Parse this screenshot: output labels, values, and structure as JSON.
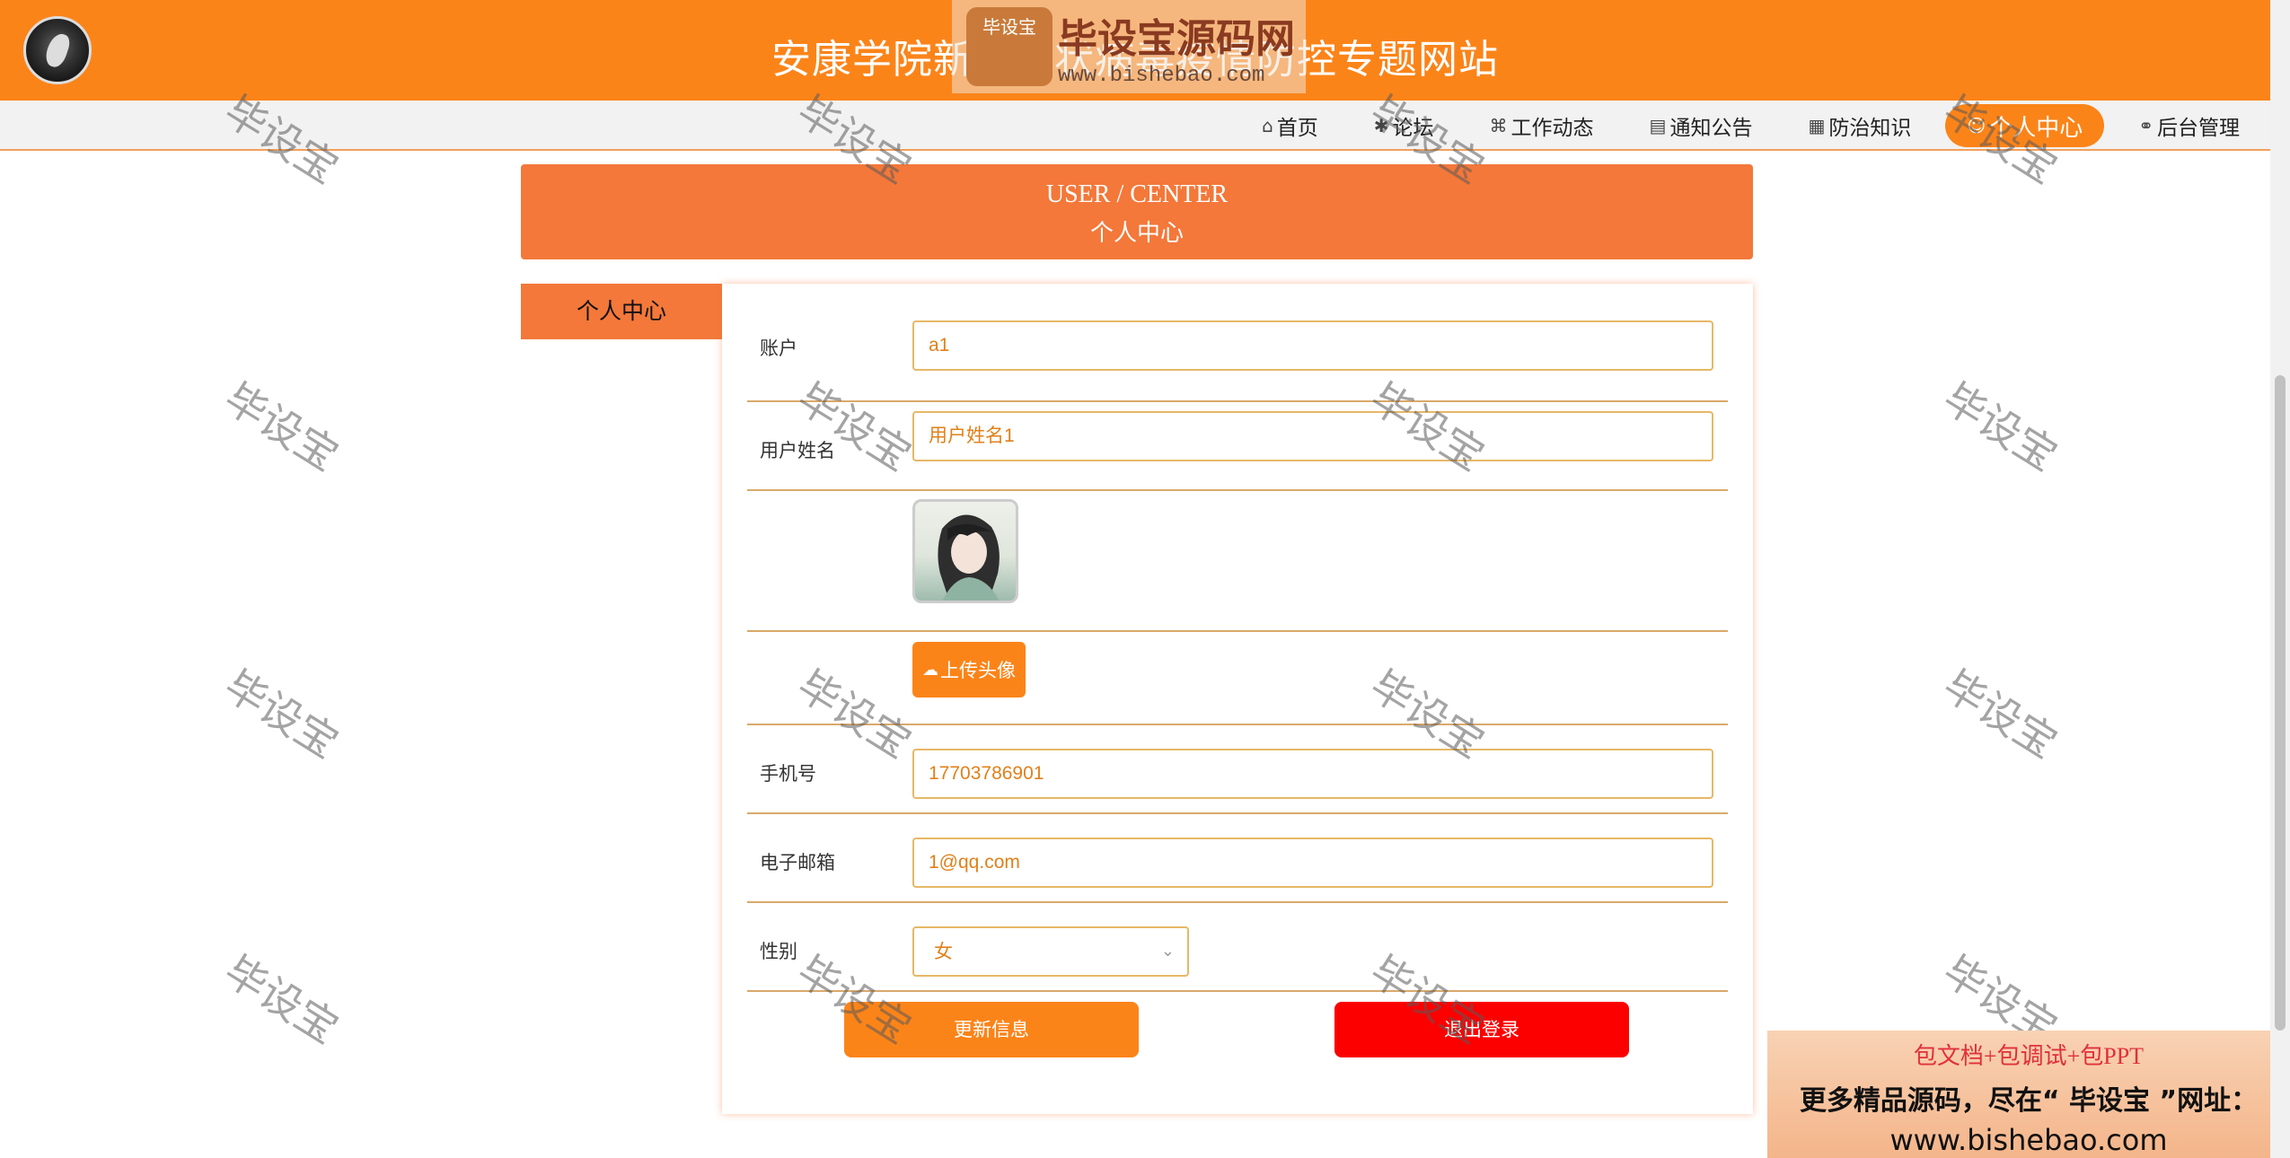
{
  "header": {
    "title": "安康学院新型冠状病毒疫情防控专题网站"
  },
  "nav": {
    "items": [
      {
        "icon": "home-icon",
        "glyph": "⌂",
        "label": "首页",
        "active": false
      },
      {
        "icon": "forum-icon",
        "glyph": "✱",
        "label": "论坛",
        "active": false
      },
      {
        "icon": "book-icon",
        "glyph": "⌘",
        "label": "工作动态",
        "active": false
      },
      {
        "icon": "notice-icon",
        "glyph": "▤",
        "label": "通知公告",
        "active": false
      },
      {
        "icon": "apps-icon",
        "glyph": "▦",
        "label": "防治知识",
        "active": false
      },
      {
        "icon": "user-icon",
        "glyph": "☺",
        "label": "个人中心",
        "active": true
      },
      {
        "icon": "link-icon",
        "glyph": "⚭",
        "label": "后台管理",
        "active": false
      }
    ]
  },
  "banner": {
    "en": "USER / CENTER",
    "cn": "个人中心"
  },
  "sidebar": {
    "tab": "个人中心"
  },
  "form": {
    "account": {
      "label": "账户",
      "value": "a1"
    },
    "username": {
      "label": "用户姓名",
      "value": "用户姓名1"
    },
    "upload_label": "上传头像",
    "phone": {
      "label": "手机号",
      "value": "17703786901"
    },
    "email": {
      "label": "电子邮箱",
      "value": "1@qq.com"
    },
    "gender": {
      "label": "性别",
      "value": "女"
    },
    "update_button": "更新信息",
    "logout_button": "退出登录"
  },
  "watermark": {
    "text": "毕设宝",
    "badge": "毕设宝",
    "top_title": "毕设宝源码网",
    "top_url": "www.bishebao.com"
  },
  "ad": {
    "line1": "包文档+包调试+包PPT",
    "line2": "更多精品源码，尽在“ 毕设宝 ”网址：",
    "line3": "www.bishebao.com"
  },
  "colors": {
    "accent": "#fb8419",
    "banner": "#f3783a",
    "logout": "#fc0000"
  }
}
